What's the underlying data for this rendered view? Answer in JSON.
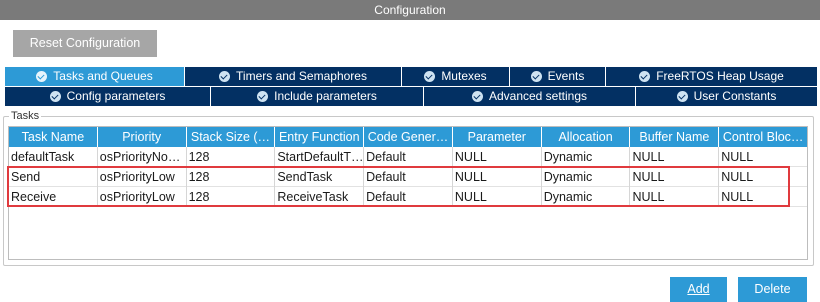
{
  "window": {
    "title": "Configuration"
  },
  "toolbar": {
    "reset_label": "Reset Configuration"
  },
  "tabs_row1": [
    {
      "label": "Tasks and Queues",
      "active": true
    },
    {
      "label": "Timers and Semaphores",
      "active": false
    },
    {
      "label": "Mutexes",
      "active": false
    },
    {
      "label": "Events",
      "active": false
    },
    {
      "label": "FreeRTOS Heap Usage",
      "active": false
    }
  ],
  "tabs_row2": [
    {
      "label": "Config parameters"
    },
    {
      "label": "Include parameters"
    },
    {
      "label": "Advanced settings"
    },
    {
      "label": "User Constants"
    }
  ],
  "tasks": {
    "group_label": "Tasks",
    "columns": [
      "Task Name",
      "Priority",
      "Stack Size (…",
      "Entry Function",
      "Code Gener…",
      "Parameter",
      "Allocation",
      "Buffer Name",
      "Control Bloc…"
    ],
    "rows": [
      [
        "defaultTask",
        "osPriorityNo…",
        "128",
        "StartDefaultT…",
        "Default",
        "NULL",
        "Dynamic",
        "NULL",
        "NULL"
      ],
      [
        "Send",
        "osPriorityLow",
        "128",
        "SendTask",
        "Default",
        "NULL",
        "Dynamic",
        "NULL",
        "NULL"
      ],
      [
        "Receive",
        "osPriorityLow",
        "128",
        "ReceiveTask",
        "Default",
        "NULL",
        "Dynamic",
        "NULL",
        "NULL"
      ]
    ]
  },
  "actions": {
    "add_label": "Add",
    "delete_label": "Delete"
  },
  "colors": {
    "accent": "#2d9ad6",
    "tab_dark": "#033063",
    "highlight": "#e03a3e",
    "titlebar": "#7a7a7a"
  }
}
